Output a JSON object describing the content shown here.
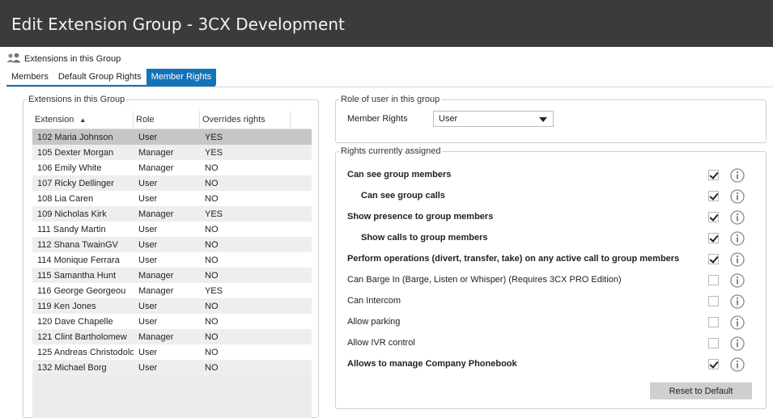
{
  "window": {
    "title": "Edit Extension Group - 3CX Development"
  },
  "section": {
    "title": "Extensions in this Group",
    "icon": "group-users-icon"
  },
  "tabs": [
    {
      "label": "Members",
      "active": false
    },
    {
      "label": "Default Group Rights",
      "active": false
    },
    {
      "label": "Member Rights",
      "active": true
    }
  ],
  "left_panel": {
    "legend": "Extensions in this Group",
    "columns": [
      "Extension",
      "Role",
      "Overrides rights"
    ],
    "sort_indicator": "▲",
    "rows": [
      {
        "extension": "102 Maria Johnson",
        "role": "User",
        "overrides": "YES",
        "selected": true
      },
      {
        "extension": "105 Dexter Morgan",
        "role": "Manager",
        "overrides": "YES"
      },
      {
        "extension": "106 Emily White",
        "role": "Manager",
        "overrides": "NO"
      },
      {
        "extension": "107 Ricky Dellinger",
        "role": "User",
        "overrides": "NO"
      },
      {
        "extension": "108 Lia Caren",
        "role": "User",
        "overrides": "NO"
      },
      {
        "extension": "109 Nicholas Kirk",
        "role": "Manager",
        "overrides": "YES"
      },
      {
        "extension": "111 Sandy Martin",
        "role": "User",
        "overrides": "NO"
      },
      {
        "extension": "112 Shana TwainGV",
        "role": "User",
        "overrides": "NO"
      },
      {
        "extension": "114 Monique Ferrara",
        "role": "User",
        "overrides": "NO"
      },
      {
        "extension": "115 Samantha Hunt",
        "role": "Manager",
        "overrides": "NO"
      },
      {
        "extension": "116 George Georgeou",
        "role": "Manager",
        "overrides": "YES"
      },
      {
        "extension": "119 Ken Jones",
        "role": "User",
        "overrides": "NO"
      },
      {
        "extension": "120 Dave Chapelle",
        "role": "User",
        "overrides": "NO"
      },
      {
        "extension": "121 Clint Bartholomew",
        "role": "Manager",
        "overrides": "NO"
      },
      {
        "extension": "125 Andreas Christodolo",
        "role": "User",
        "overrides": "NO"
      },
      {
        "extension": "132 Michael Borg",
        "role": "User",
        "overrides": "NO"
      }
    ]
  },
  "role_panel": {
    "legend": "Role of user in this group",
    "field_label": "Member Rights",
    "selected_value": "User"
  },
  "rights_panel": {
    "legend": "Rights currently assigned",
    "rights": [
      {
        "label": "Can see group members",
        "checked": true,
        "bold": true,
        "indent": false
      },
      {
        "label": "Can see group calls",
        "checked": true,
        "bold": true,
        "indent": true
      },
      {
        "label": "Show presence to group members",
        "checked": true,
        "bold": true,
        "indent": false
      },
      {
        "label": "Show calls to group members",
        "checked": true,
        "bold": true,
        "indent": true
      },
      {
        "label": "Perform operations (divert, transfer, take) on any active call to group members",
        "checked": true,
        "bold": true,
        "indent": false
      },
      {
        "label": "Can Barge In (Barge, Listen or Whisper) (Requires 3CX PRO Edition)",
        "checked": false,
        "bold": false,
        "indent": false
      },
      {
        "label": "Can Intercom",
        "checked": false,
        "bold": false,
        "indent": false
      },
      {
        "label": "Allow parking",
        "checked": false,
        "bold": false,
        "indent": false
      },
      {
        "label": "Allow IVR control",
        "checked": false,
        "bold": false,
        "indent": false
      },
      {
        "label": "Allows to manage Company Phonebook",
        "checked": true,
        "bold": true,
        "indent": false
      }
    ],
    "reset_label": "Reset to Default"
  },
  "colors": {
    "titlebar": "#3b3b3b",
    "accent": "#1473b8",
    "selected_row": "#c6c6c6"
  }
}
